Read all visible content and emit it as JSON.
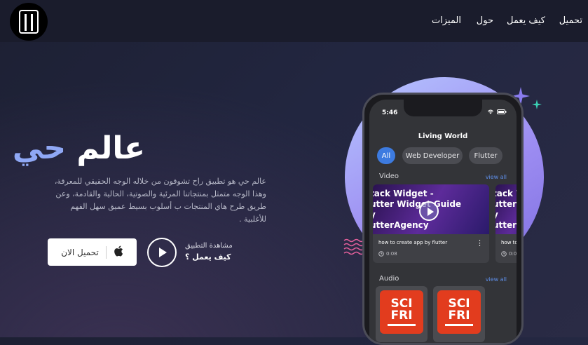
{
  "nav": {
    "items": [
      "تحميل",
      "كيف يعمل",
      "حول",
      "الميزات"
    ]
  },
  "hero": {
    "title_part1": "عالم",
    "title_part2": "حي",
    "description": "عالم حي هو تطبيق راح تشوفون من خلاله الوجه الحقيقي للمعرفة، وهذا الوجه متمثل بمنتجاتنا المرئية والصوتية، الحالية والقادمة، وعن طريق طرح هاي المنتجات ب أسلوب بسيط عميق سهل الفهم للأغلبية ."
  },
  "download": {
    "label": "تحميل الان",
    "icon": "apple-icon"
  },
  "watch": {
    "line1": "مشاهدة التطبيق",
    "line2": "كيف يعمل ؟"
  },
  "phone": {
    "time": "5:46",
    "app_title": "Living World",
    "chips": [
      "All",
      "Web Developer",
      "Flutter"
    ],
    "video_section": "Video",
    "audio_section": "Audio",
    "view_all": "view all",
    "video_cards": [
      {
        "thumb_text": "tack Widget -\nutter Widget Guide\ny\nutterAgency",
        "caption": "how to create app by flutter",
        "duration": "0:08"
      },
      {
        "thumb_text": "tack W\nutter W\ny\nutterA",
        "caption": "how to create",
        "duration": "0:08"
      }
    ],
    "audio_cards": [
      {
        "line1": "SCI",
        "line2": "FRI"
      },
      {
        "line1": "SCI",
        "line2": "FRI"
      }
    ]
  },
  "colors": {
    "accent": "#8fa8f5",
    "chip_active": "#3d7be0",
    "link": "#5e8ee8",
    "audio_art": "#e23c1e"
  }
}
